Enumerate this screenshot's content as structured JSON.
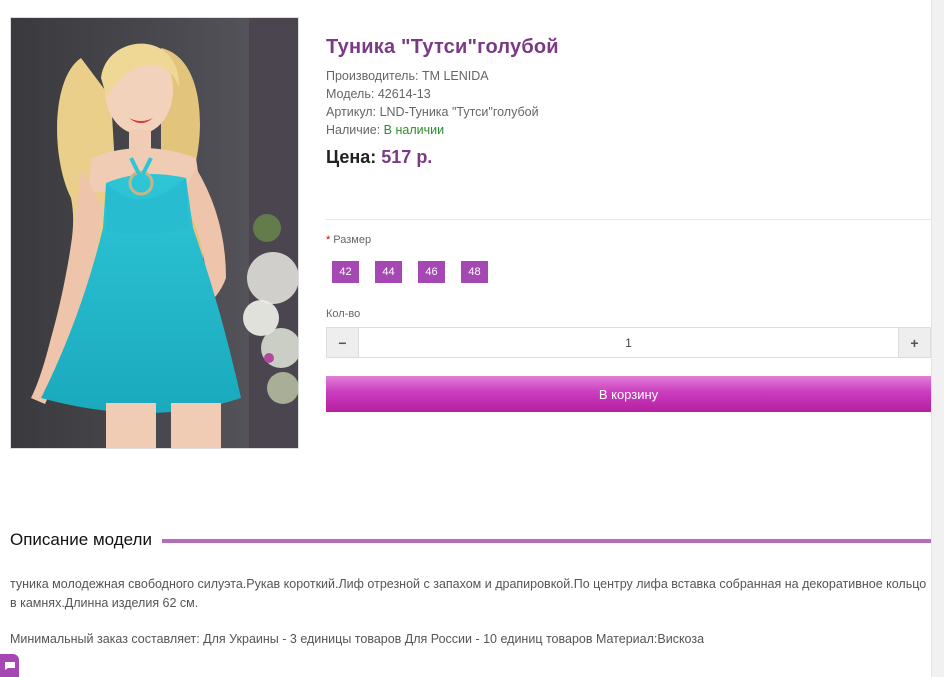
{
  "product": {
    "title": "Туника \"Тутси\"голубой",
    "manufacturer_label": "Производитель:",
    "manufacturer": "TM LENIDA",
    "model_label": "Модель:",
    "model": "42614-13",
    "sku_label": "Артикул:",
    "sku": "LND-Туника \"Тутси\"голубой",
    "availability_label": "Наличие:",
    "availability": "В наличии",
    "price_label": "Цена:",
    "price": "517 р.",
    "image_alt": "woman-in-turquoise-tunic"
  },
  "options": {
    "required_mark": "*",
    "size_label": "Размер",
    "sizes": [
      "42",
      "44",
      "46",
      "48"
    ],
    "size_color": "#a648b4"
  },
  "quantity": {
    "label": "Кол-во",
    "value": "1",
    "minus_icon": "−",
    "plus_icon": "+"
  },
  "cart": {
    "button_label": "В корзину",
    "color": "#c636b8"
  },
  "description": {
    "heading": "Описание модели",
    "text_1": "туника молодежная свободного силуэта.Рукав короткий.Лиф отрезной с запахом и драпировкой.По центру лифа вставка собранная на декоративное кольцо в камнях.Длинна изделия 62 см.",
    "text_2": "Минимальный заказ составляет: Для Украины - 3 единицы товаров Для России - 10 единиц товаров Материал:Вискоза"
  },
  "colors": {
    "accent": "#7b3a86",
    "in_stock": "#2e8b2e"
  }
}
